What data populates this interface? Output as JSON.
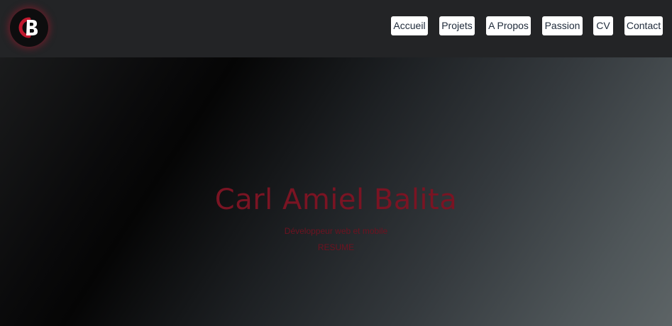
{
  "header": {
    "logo_text": "CB",
    "nav": [
      {
        "label": "Accueil"
      },
      {
        "label": "Projets"
      },
      {
        "label": "A Propos"
      },
      {
        "label": "Passion"
      },
      {
        "label": "CV"
      },
      {
        "label": "Contact"
      }
    ]
  },
  "hero": {
    "name": "Carl Amiel Balita",
    "subtitle": "Développeur web et mobile",
    "tagline": "RESUME"
  },
  "colors": {
    "header_bg": "#232426",
    "accent_red": "#7a1423",
    "nav_button_bg": "#ffffff",
    "nav_button_text": "#1e2a3a"
  }
}
